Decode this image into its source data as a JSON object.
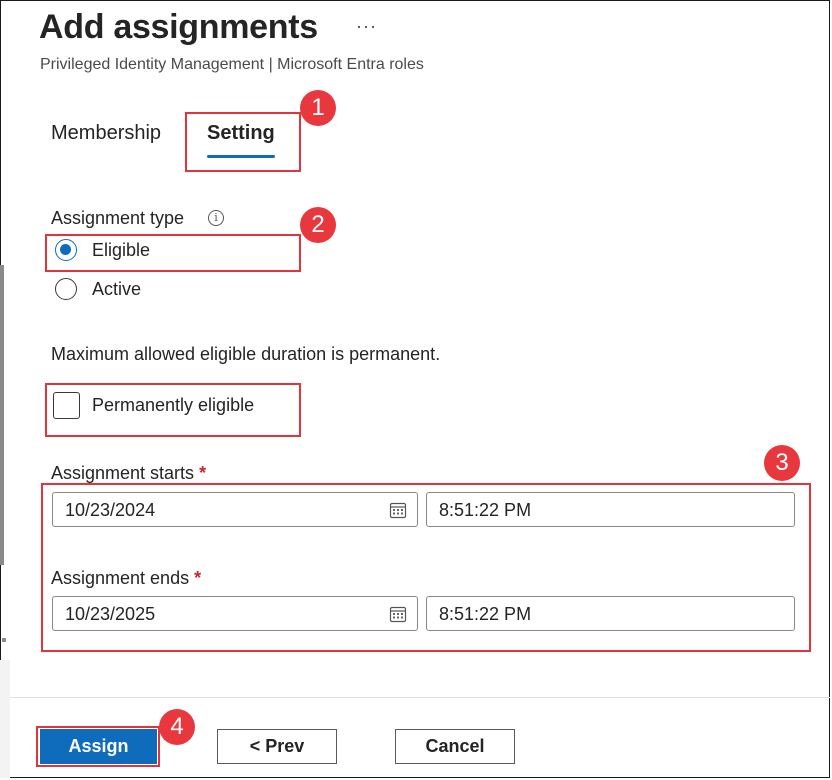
{
  "header": {
    "title": "Add assignments",
    "more_label": "···",
    "subtitle": "Privileged Identity Management | Microsoft Entra roles"
  },
  "tabs": {
    "membership": "Membership",
    "setting": "Setting",
    "selected": "Setting"
  },
  "assignment_type": {
    "label": "Assignment type",
    "info_icon": "i",
    "options": [
      {
        "label": "Eligible",
        "selected": true
      },
      {
        "label": "Active",
        "selected": false
      }
    ]
  },
  "duration_note": "Maximum allowed eligible duration is permanent.",
  "permanently_eligible": {
    "label": "Permanently eligible",
    "checked": false
  },
  "assignment_starts": {
    "label": "Assignment starts",
    "required_mark": "*",
    "date": "10/23/2024",
    "time": "8:51:22 PM"
  },
  "assignment_ends": {
    "label": "Assignment ends",
    "required_mark": "*",
    "date": "10/23/2025",
    "time": "8:51:22 PM"
  },
  "footer": {
    "assign": "Assign",
    "prev": "< Prev",
    "cancel": "Cancel"
  },
  "annotations": {
    "badge_1": "1",
    "badge_2": "2",
    "badge_3": "3",
    "badge_4": "4"
  },
  "colors": {
    "accent": "#0f6cbd",
    "highlight": "#e0353d",
    "badge": "#e8383e",
    "required": "#c4262e"
  }
}
